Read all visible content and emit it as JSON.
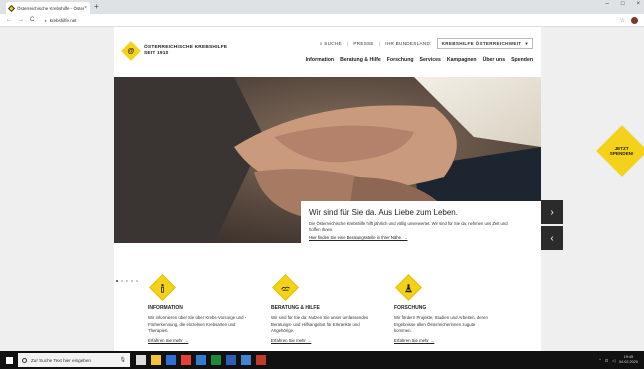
{
  "browser": {
    "tab_title": "Österreichische Krebshilfe - Österreich",
    "tab_close": "×",
    "new_tab": "+",
    "url": "krebshilfe.net",
    "window_controls": [
      "–",
      "□",
      "×"
    ],
    "nav_back": "←",
    "nav_forward": "→",
    "nav_reload": "C"
  },
  "header": {
    "logo_line1": "ÖSTERREICHISCHE KREBSHILFE",
    "logo_line2": "SEIT 1910",
    "logo_icon": "@",
    "util": {
      "search": "SUCHE",
      "press": "PRESSE",
      "region_label": "IHR BUNDESLAND:",
      "region_value": "KREBSHILFE ÖSTERREICHWEIT",
      "region_caret": "▾"
    },
    "nav": [
      "Information",
      "Beratung & Hilfe",
      "Forschung",
      "Services",
      "Kampagnen",
      "Über uns",
      "Spenden"
    ]
  },
  "hero": {
    "headline": "Wir sind für Sie da. Aus Liebe zum Leben.",
    "body": "Die Österreichische Krebshilfe hilft jährlich und völlig unverwertet. Wir sind für Sie da, nehmen uns Zeit und hoffen Ihnen.",
    "link": "Hier finden Sie eine Beratungsstelle in Ihrer Nähe. →",
    "next": "›",
    "prev": "‹",
    "dots_count": 5
  },
  "donate": {
    "line1": "JETZT",
    "line2": "SPENDEN!"
  },
  "features": [
    {
      "title": "INFORMATION",
      "text": "Wir informieren über Sie über Krebs-Vorsorge und -Früherkennung, die einzelnen Krebsarten und Therapien.",
      "link": "Erfahren Sie mehr →",
      "icon": "info-icon"
    },
    {
      "title": "BERATUNG & HILFE",
      "text": "Wir sind für Sie da: Nutzen Sie unser umfassendes Beratungs- und Hilfsangebot für Erkrankte und Angehörige.",
      "link": "Erfahren Sie mehr →",
      "icon": "hands-icon"
    },
    {
      "title": "FORSCHUNG",
      "text": "Wir fördern Projekte, Studien und Arbeiten, deren Ergebnisse allen Österreicherinnen zugute kommen.",
      "link": "Erfahren Sie mehr →",
      "icon": "flask-icon"
    }
  ],
  "taskbar": {
    "search_placeholder": "Zur Suche Text hier eingeben",
    "time": "19:45",
    "date": "04.02.2020"
  },
  "colors": {
    "accent_yellow": "#f5d21a",
    "dark": "#2b2b2b"
  }
}
